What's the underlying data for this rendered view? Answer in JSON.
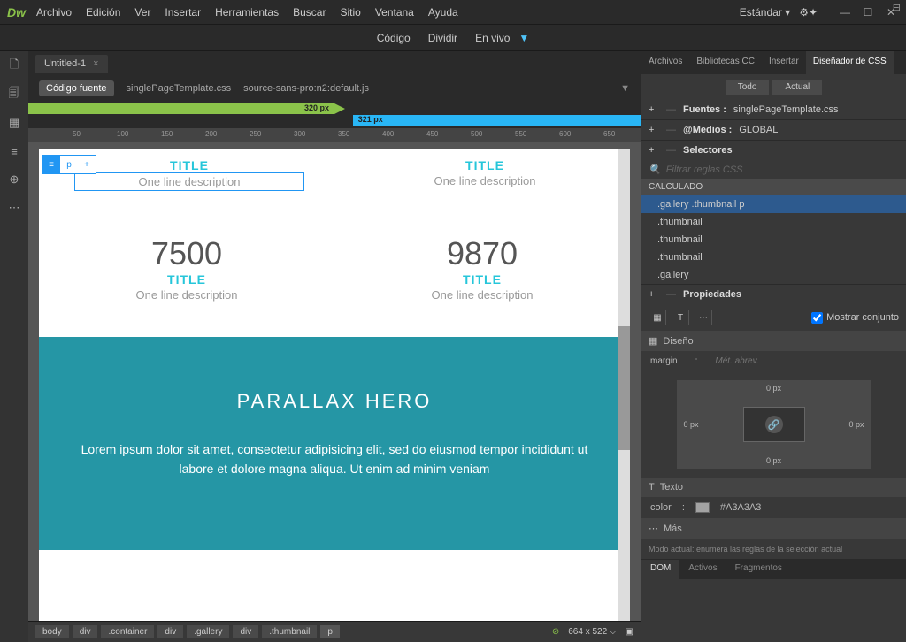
{
  "app": {
    "logo": "Dw"
  },
  "menu": [
    "Archivo",
    "Edición",
    "Ver",
    "Insertar",
    "Herramientas",
    "Buscar",
    "Sitio",
    "Ventana",
    "Ayuda"
  ],
  "workspace": "Estándar",
  "viewmodes": {
    "code": "Código",
    "split": "Dividir",
    "live": "En vivo"
  },
  "document": {
    "title": "Untitled-1"
  },
  "file_tabs": {
    "source": "Código fuente",
    "files": [
      "singlePageTemplate.css",
      "source-sans-pro:n2:default.js"
    ]
  },
  "media_queries": {
    "green_px": "320  px",
    "blue_px": "321  px"
  },
  "ruler_ticks": [
    "50",
    "100",
    "150",
    "200",
    "250",
    "300",
    "350",
    "400",
    "450",
    "500",
    "550",
    "600",
    "650"
  ],
  "canvas": {
    "thumbs": [
      {
        "title": "TITLE",
        "desc": "One line description"
      },
      {
        "title": "TITLE",
        "desc": "One line description"
      }
    ],
    "stats": [
      {
        "num": "7500",
        "title": "TITLE",
        "desc": "One line description"
      },
      {
        "num": "9870",
        "title": "TITLE",
        "desc": "One line description"
      }
    ],
    "parallax": {
      "heading": "PARALLAX HERO",
      "text": "Lorem ipsum dolor sit amet, consectetur adipisicing elit, sed do eiusmod tempor incididunt ut labore et dolore magna aliqua. Ut enim ad minim veniam"
    }
  },
  "breadcrumbs": [
    "body",
    "div",
    ".container",
    "div",
    ".gallery",
    "div",
    ".thumbnail",
    "p"
  ],
  "viewport_size": "664 x 522",
  "panels": {
    "top_tabs": [
      "Archivos",
      "Bibliotecas CC",
      "Insertar",
      "Diseñador de CSS"
    ],
    "sub_tabs": [
      "Todo",
      "Actual"
    ],
    "sources": {
      "label": "Fuentes :",
      "value": "singlePageTemplate.css"
    },
    "media": {
      "label": "@Medios :",
      "value": "GLOBAL"
    },
    "selectors": {
      "label": "Selectores",
      "filter_placeholder": "Filtrar reglas CSS",
      "calculated": "CALCULADO",
      "items": [
        ".gallery .thumbnail p",
        ".thumbnail",
        ".thumbnail",
        ".thumbnail",
        ".gallery"
      ]
    },
    "properties": {
      "label": "Propiedades",
      "show_set": "Mostrar conjunto",
      "layout_label": "Diseño",
      "margin_label": "margin",
      "margin_placeholder": "Mét. abrev.",
      "box_vals": {
        "top": "0 px",
        "right": "0 px",
        "bottom": "0 px",
        "left": "0 px"
      },
      "text_label": "Texto",
      "color_label": "color",
      "color_value": "#A3A3A3",
      "more_label": "Más",
      "mode_text": "Modo actual: enumera las reglas de la selección actual"
    },
    "bottom_tabs": [
      "DOM",
      "Activos",
      "Fragmentos"
    ]
  }
}
